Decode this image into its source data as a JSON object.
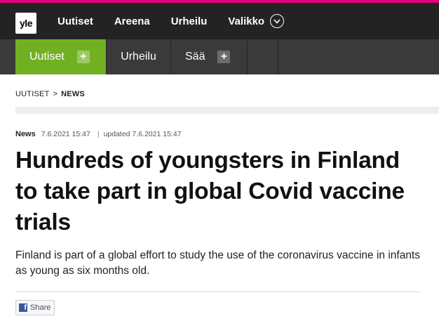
{
  "brand": {
    "logo_text": "yle",
    "accent": "#e6007e"
  },
  "topnav": {
    "items": [
      "Uutiset",
      "Areena",
      "Urheilu"
    ],
    "menu_label": "Valikko"
  },
  "subnav": {
    "active_label": "Uutiset",
    "urheilu_label": "Urheilu",
    "saa_label": "Sää",
    "plus_symbol": "+",
    "active_color": "#72b023"
  },
  "breadcrumb": {
    "root": "UUTISET",
    "separator": ">",
    "current": "NEWS"
  },
  "article": {
    "category": "News",
    "published": "7.6.2021 15:47",
    "updated": "updated 7.6.2021 15:47",
    "meta_divider": "|",
    "title": "Hundreds of youngsters in Finland to take part in global Covid vaccine trials",
    "lead": "Finland is part of a global effort to study the use of the coronavirus vaccine in infants as young as six months old."
  },
  "share": {
    "label": "Share",
    "icon_letter": "f"
  }
}
